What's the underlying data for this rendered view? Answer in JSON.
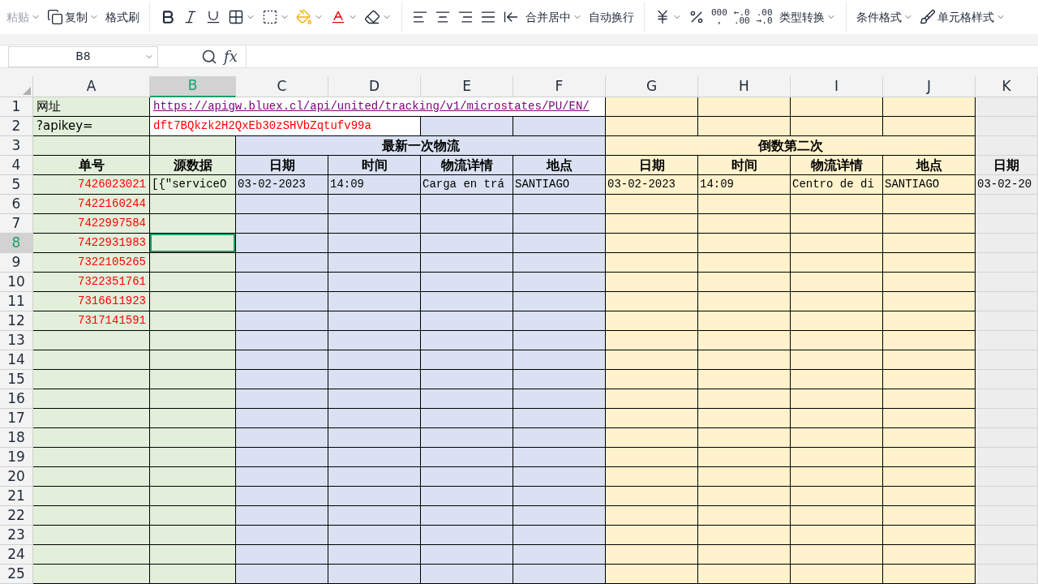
{
  "toolbar": {
    "paste": {
      "label": "粘贴",
      "disabled": true
    },
    "copy": "复制",
    "format_painter": "格式刷",
    "merge": "合并居中",
    "wrap": "自动换行",
    "number_buttons": [
      "000 ,",
      "←.0 .00",
      ".00 →.0"
    ],
    "convert": "类型转换",
    "conditional": "条件格式",
    "cell_style": "单元格样式"
  },
  "formula_bar": {
    "name_box": "B8",
    "fx": "fx"
  },
  "columns": [
    {
      "letter": "A",
      "selected": false
    },
    {
      "letter": "B",
      "selected": true
    },
    {
      "letter": "C",
      "selected": false
    },
    {
      "letter": "D",
      "selected": false
    },
    {
      "letter": "E",
      "selected": false
    },
    {
      "letter": "F",
      "selected": false
    },
    {
      "letter": "G",
      "selected": false
    },
    {
      "letter": "H",
      "selected": false
    },
    {
      "letter": "I",
      "selected": false
    },
    {
      "letter": "J",
      "selected": false
    },
    {
      "letter": "K",
      "selected": false
    }
  ],
  "rows": [
    {
      "number": "1",
      "selected": false,
      "cells": [
        {
          "kind": "label",
          "text": "网址"
        },
        {
          "kind": "link",
          "text": "https://apigw.bluex.cl/api/united/tracking/v1/microstates/PU/EN/"
        }
      ]
    },
    {
      "number": "2",
      "selected": false,
      "cells": [
        {
          "kind": "label",
          "text": "?apikey="
        },
        {
          "kind": "key",
          "text": "dft7BQkzk2H2QxEb30zSHVbZqtufv99a"
        }
      ]
    },
    {
      "number": "3",
      "selected": false,
      "cells": [
        {
          "kind": "blank"
        },
        {
          "kind": "blank"
        },
        {
          "kind": "group",
          "text": "最新一次物流"
        },
        {
          "kind": "group",
          "text": "倒数第二次"
        }
      ]
    },
    {
      "number": "4",
      "selected": false,
      "cells": [
        {
          "kind": "header",
          "text": "单号"
        },
        {
          "kind": "header",
          "text": "源数据"
        },
        {
          "kind": "header",
          "text": "日期"
        },
        {
          "kind": "header",
          "text": "时间"
        },
        {
          "kind": "header",
          "text": "物流详情"
        },
        {
          "kind": "header",
          "text": "地点"
        },
        {
          "kind": "header",
          "text": "日期"
        },
        {
          "kind": "header",
          "text": "时间"
        },
        {
          "kind": "header",
          "text": "物流详情"
        },
        {
          "kind": "header",
          "text": "地点"
        },
        {
          "kind": "header",
          "text": "日期"
        }
      ]
    },
    {
      "number": "5",
      "selected": false,
      "cells": [
        {
          "kind": "id",
          "text": "7426023021"
        },
        {
          "kind": "text",
          "text": "[{″serviceO"
        },
        {
          "kind": "text",
          "text": "03-02-2023"
        },
        {
          "kind": "text",
          "text": "14:09"
        },
        {
          "kind": "text",
          "text": "Carga en trá"
        },
        {
          "kind": "text",
          "text": "SANTIAGO"
        },
        {
          "kind": "text",
          "text": "03-02-2023"
        },
        {
          "kind": "text",
          "text": "14:09"
        },
        {
          "kind": "text",
          "text": "Centro de di"
        },
        {
          "kind": "text",
          "text": "SANTIAGO"
        },
        {
          "kind": "text",
          "text": "03-02-20"
        }
      ]
    },
    {
      "number": "6",
      "selected": false,
      "cells": [
        {
          "kind": "id",
          "text": "7422160244"
        }
      ]
    },
    {
      "number": "7",
      "selected": false,
      "cells": [
        {
          "kind": "id",
          "text": "7422997584"
        }
      ]
    },
    {
      "number": "8",
      "selected": true,
      "cells": [
        {
          "kind": "id",
          "text": "7422931983"
        }
      ]
    },
    {
      "number": "9",
      "selected": false,
      "cells": [
        {
          "kind": "id",
          "text": "7322105265"
        }
      ]
    },
    {
      "number": "10",
      "selected": false,
      "cells": [
        {
          "kind": "id",
          "text": "7322351761"
        }
      ]
    },
    {
      "number": "11",
      "selected": false,
      "cells": [
        {
          "kind": "id",
          "text": "7316611923"
        }
      ]
    },
    {
      "number": "12",
      "selected": false,
      "cells": [
        {
          "kind": "id",
          "text": "7317141591"
        }
      ]
    },
    {
      "number": "13",
      "selected": false,
      "cells": []
    },
    {
      "number": "14",
      "selected": false,
      "cells": []
    },
    {
      "number": "15",
      "selected": false,
      "cells": []
    },
    {
      "number": "16",
      "selected": false,
      "cells": []
    },
    {
      "number": "17",
      "selected": false,
      "cells": []
    },
    {
      "number": "18",
      "selected": false,
      "cells": []
    },
    {
      "number": "19",
      "selected": false,
      "cells": []
    },
    {
      "number": "20",
      "selected": false,
      "cells": []
    },
    {
      "number": "21",
      "selected": false,
      "cells": []
    },
    {
      "number": "22",
      "selected": false,
      "cells": []
    },
    {
      "number": "23",
      "selected": false,
      "cells": []
    },
    {
      "number": "24",
      "selected": false,
      "cells": []
    },
    {
      "number": "25",
      "selected": false,
      "cells": []
    }
  ]
}
